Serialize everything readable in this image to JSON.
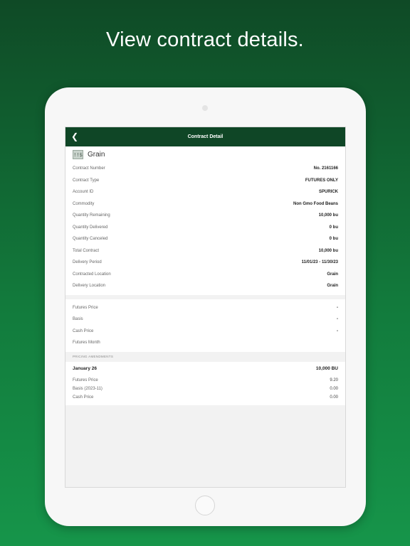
{
  "headline": "View contract details.",
  "navbar": {
    "title": "Contract Detail",
    "back_icon": "chevron-left-icon"
  },
  "header": {
    "icon": "grain-icon",
    "icon_glyph": "!!$",
    "title": "Grain"
  },
  "details": [
    {
      "label": "Contract Number",
      "value": "No. 2161166"
    },
    {
      "label": "Contract Type",
      "value": "FUTURES ONLY"
    },
    {
      "label": "Account ID",
      "value": "SPURICK"
    },
    {
      "label": "Commodity",
      "value": "Non Gmo Food Beans"
    },
    {
      "label": "Quantity Remaining",
      "value": "10,000 bu"
    },
    {
      "label": "Quantity Delivered",
      "value": "0 bu"
    },
    {
      "label": "Quantity Canceled",
      "value": "0 bu"
    },
    {
      "label": "Total Contract",
      "value": "10,000 bu"
    },
    {
      "label": "Delivery Period",
      "value": "11/01/23 - 11/30/23"
    },
    {
      "label": "Contracted Location",
      "value": "Grain"
    },
    {
      "label": "Delivery Location",
      "value": "Grain"
    }
  ],
  "pricing": [
    {
      "label": "Futures Price",
      "value": "-"
    },
    {
      "label": "Basis",
      "value": "-"
    },
    {
      "label": "Cash Price",
      "value": "-"
    },
    {
      "label": "Futures Month",
      "value": ""
    }
  ],
  "amendments": {
    "section_label": "PRICING AMENDMENTS",
    "date": "January 26",
    "quantity": "10,000 BU",
    "rows": [
      {
        "label": "Futures Price",
        "value": "9.20"
      },
      {
        "label": "Basis (2023-11)",
        "value": "0.00"
      },
      {
        "label": "Cash Price",
        "value": "0.00"
      }
    ]
  }
}
